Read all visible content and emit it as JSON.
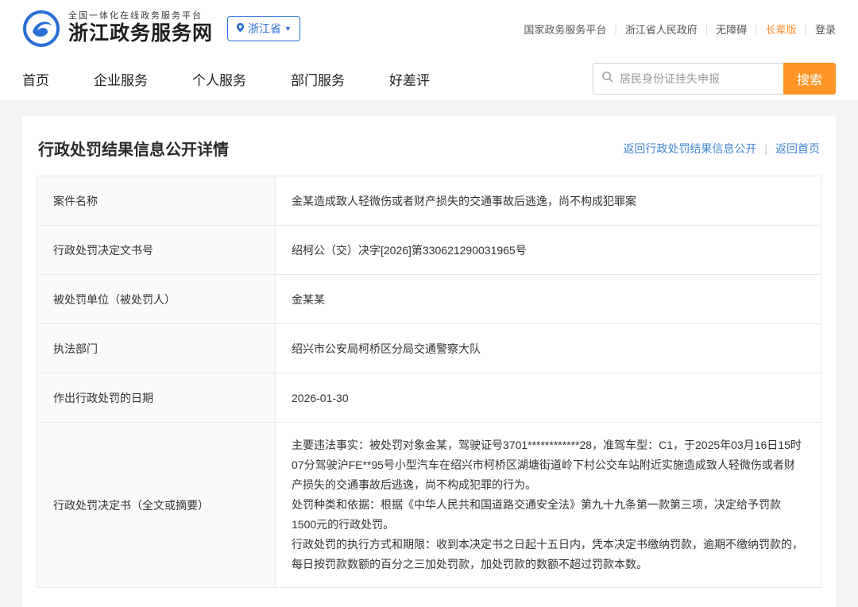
{
  "header": {
    "platform_tagline": "全国一体化在线政务服务平台",
    "site_title": "浙江政务服务网",
    "region": "浙江省",
    "links": {
      "national": "国家政务服务平台",
      "provincial": "浙江省人民政府",
      "accessibility": "无障碍",
      "elder": "长辈版",
      "login": "登录"
    }
  },
  "nav": {
    "items": [
      "首页",
      "企业服务",
      "个人服务",
      "部门服务",
      "好差评"
    ],
    "search": {
      "placeholder": "居民身份证挂失申报",
      "button": "搜索"
    }
  },
  "main": {
    "title": "行政处罚结果信息公开详情",
    "back_link": "返回行政处罚结果信息公开",
    "home_link": "返回首页",
    "table": {
      "rows": [
        {
          "label": "案件名称",
          "value": "金某造成致人轻微伤或者财产损失的交通事故后逃逸，尚不构成犯罪案"
        },
        {
          "label": "行政处罚决定文书号",
          "value": "绍柯公（交）决字[2026]第330621290031965号"
        },
        {
          "label": "被处罚单位（被处罚人）",
          "value": "金某某"
        },
        {
          "label": "执法部门",
          "value": "绍兴市公安局柯桥区分局交通警察大队"
        },
        {
          "label": "作出行政处罚的日期",
          "value": "2026-01-30"
        },
        {
          "label": "行政处罚决定书（全文或摘要）",
          "value": "主要违法事实：被处罚对象金某，驾驶证号3701************28，准驾车型：C1，于2025年03月16日15时07分驾驶沪FE**95号小型汽车在绍兴市柯桥区湖塘街道岭下村公交车站附近实施造成致人轻微伤或者财产损失的交通事故后逃逸，尚不构成犯罪的行为。\n处罚种类和依据：根据《中华人民共和国道路交通安全法》第九十九条第一款第三项，决定给予罚款1500元的行政处罚。\n行政处罚的执行方式和期限：收到本决定书之日起十五日内，凭本决定书缴纳罚款，逾期不缴纳罚款的，每日按罚款数额的百分之三加处罚款，加处罚款的数额不超过罚款本数。"
        }
      ]
    }
  },
  "colors": {
    "accent_blue": "#2a6fd6",
    "accent_orange": "#ff9526",
    "link_blue": "#4285d3",
    "elder_orange": "#ff8a2b"
  },
  "icons": {
    "logo": "zhejiang-gov-logo",
    "region_pin": "location-pin",
    "region_caret": "caret-down",
    "search": "magnifier"
  }
}
